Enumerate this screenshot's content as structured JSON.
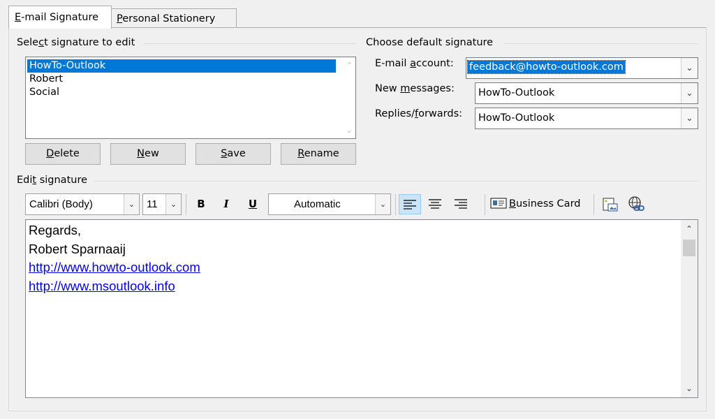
{
  "tabs": {
    "email_signature": {
      "pre": "",
      "key": "E",
      "post": "-mail Signature"
    },
    "personal_stationery": {
      "pre": "",
      "key": "P",
      "post": "ersonal Stationery"
    }
  },
  "select_group": {
    "pre": "Sele",
    "key": "c",
    "post": "t signature to edit"
  },
  "signatures": [
    "HowTo-Outlook",
    "Robert",
    "Social"
  ],
  "buttons": {
    "delete": {
      "pre": "",
      "key": "D",
      "post": "elete"
    },
    "new": {
      "pre": "",
      "key": "N",
      "post": "ew"
    },
    "save": {
      "pre": "",
      "key": "S",
      "post": "ave"
    },
    "rename": {
      "pre": "",
      "key": "R",
      "post": "ename"
    }
  },
  "default_group": {
    "label": "Choose default signature"
  },
  "email_account": {
    "label_pre": "E-mail ",
    "label_key": "a",
    "label_post": "ccount:",
    "value": "feedback@howto-outlook.com"
  },
  "new_messages": {
    "label_pre": "New ",
    "label_key": "m",
    "label_post": "essages:",
    "value": "HowTo-Outlook"
  },
  "replies": {
    "label_pre": "Replies/",
    "label_key": "f",
    "label_post": "orwards:",
    "value": "HowTo-Outlook"
  },
  "edit_group": {
    "pre": "Edi",
    "key": "t",
    "post": " signature"
  },
  "toolbar": {
    "font": "Calibri (Body)",
    "size": "11",
    "bold": "B",
    "italic": "I",
    "underline": "U",
    "color": "Automatic",
    "business_card": {
      "pre": "",
      "key": "B",
      "post": "usiness Card"
    }
  },
  "editor_lines": {
    "line1": "Regards,",
    "line2": "Robert Sparnaaij",
    "line3": "http://www.howto-outlook.com",
    "line4": "http://www.msoutlook.info"
  },
  "colors": {
    "selection": "#0078d7",
    "link": "#0000ee",
    "dialog_bg": "#f0f0f0"
  }
}
